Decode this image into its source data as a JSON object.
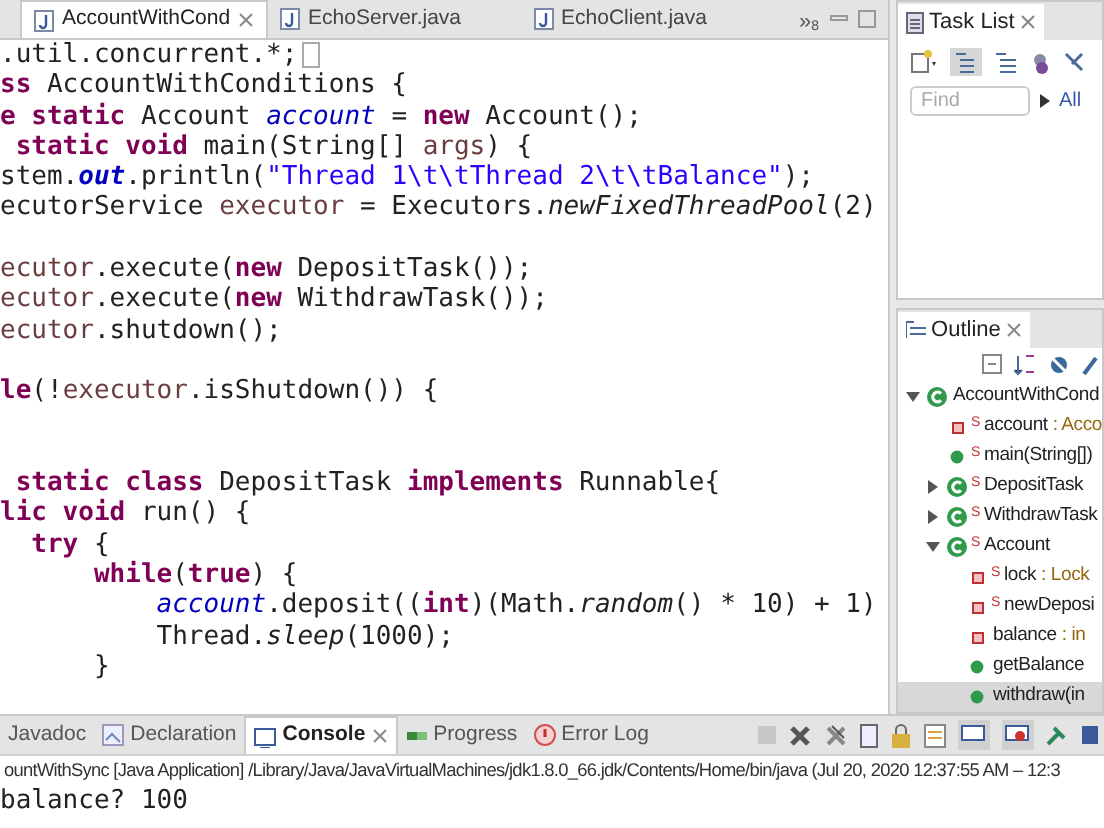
{
  "editor": {
    "imports_folded": true,
    "tabs": [
      {
        "label": "AccountWithCond",
        "selected": true
      },
      {
        "label": "EchoServer.java",
        "selected": false
      },
      {
        "label": "EchoClient.java",
        "selected": false
      }
    ],
    "overflow": {
      "label": "»",
      "count": "8"
    },
    "lines": [
      {
        "kind": "code",
        "tokens": [
          {
            "kind": "plain",
            "text": ".util.concurrent.*;"
          }
        ]
      },
      {
        "kind": "code",
        "tokens": [
          {
            "kind": "keyword",
            "text": "ss"
          },
          {
            "kind": "plain",
            "text": " AccountWithConditions {"
          }
        ]
      },
      {
        "kind": "code",
        "tokens": [
          {
            "kind": "keyword",
            "text": "e static"
          },
          {
            "kind": "plain",
            "text": " Account "
          },
          {
            "kind": "field",
            "text": "account"
          },
          {
            "kind": "plain",
            "text": " = "
          },
          {
            "kind": "keyword",
            "text": "new"
          },
          {
            "kind": "plain",
            "text": " Account();"
          }
        ]
      },
      {
        "kind": "code",
        "tokens": [
          {
            "kind": "keyword",
            "text": " static void"
          },
          {
            "kind": "plain",
            "text": " main(String[] "
          },
          {
            "kind": "variable",
            "text": "args"
          },
          {
            "kind": "plain",
            "text": ") {"
          }
        ]
      },
      {
        "kind": "code",
        "tokens": [
          {
            "kind": "plain",
            "text": "stem."
          },
          {
            "kind": "constant",
            "text": "out"
          },
          {
            "kind": "plain",
            "text": ".println("
          },
          {
            "kind": "string",
            "text": "\"Thread 1\\t\\tThread 2\\t\\tBalance\""
          },
          {
            "kind": "plain",
            "text": ");"
          }
        ]
      },
      {
        "kind": "code",
        "tokens": [
          {
            "kind": "plain",
            "text": "ecutorService "
          },
          {
            "kind": "variable",
            "text": "executor"
          },
          {
            "kind": "plain",
            "text": " = Executors."
          },
          {
            "kind": "static_method",
            "text": "newFixedThreadPool"
          },
          {
            "kind": "plain",
            "text": "(2)"
          }
        ]
      },
      {
        "kind": "blank"
      },
      {
        "kind": "code",
        "tokens": [
          {
            "kind": "variable",
            "text": "ecutor"
          },
          {
            "kind": "plain",
            "text": ".execute("
          },
          {
            "kind": "keyword",
            "text": "new"
          },
          {
            "kind": "plain",
            "text": " DepositTask());"
          }
        ]
      },
      {
        "kind": "code",
        "tokens": [
          {
            "kind": "variable",
            "text": "ecutor"
          },
          {
            "kind": "plain",
            "text": ".execute("
          },
          {
            "kind": "keyword",
            "text": "new"
          },
          {
            "kind": "plain",
            "text": " WithdrawTask());"
          }
        ]
      },
      {
        "kind": "code",
        "tokens": [
          {
            "kind": "variable",
            "text": "ecutor"
          },
          {
            "kind": "plain",
            "text": ".shutdown();"
          }
        ]
      },
      {
        "kind": "blank"
      },
      {
        "kind": "code",
        "tokens": [
          {
            "kind": "keyword",
            "text": "le"
          },
          {
            "kind": "plain",
            "text": "(!"
          },
          {
            "kind": "variable",
            "text": "executor"
          },
          {
            "kind": "plain",
            "text": ".isShutdown()) {"
          }
        ]
      },
      {
        "kind": "blank"
      },
      {
        "kind": "blank"
      },
      {
        "kind": "code",
        "tokens": [
          {
            "kind": "keyword",
            "text": " static class"
          },
          {
            "kind": "plain",
            "text": " DepositTask "
          },
          {
            "kind": "keyword",
            "text": "implements"
          },
          {
            "kind": "plain",
            "text": " Runnable{"
          }
        ]
      },
      {
        "kind": "code",
        "tokens": [
          {
            "kind": "keyword",
            "text": "lic void"
          },
          {
            "kind": "plain",
            "text": " run() {"
          }
        ]
      },
      {
        "kind": "code",
        "tokens": [
          {
            "kind": "keyword",
            "text": "  try"
          },
          {
            "kind": "plain",
            "text": " {"
          }
        ]
      },
      {
        "kind": "code",
        "tokens": [
          {
            "kind": "keyword",
            "text": "      while"
          },
          {
            "kind": "plain",
            "text": "("
          },
          {
            "kind": "keyword",
            "text": "true"
          },
          {
            "kind": "plain",
            "text": ") {"
          }
        ]
      },
      {
        "kind": "code",
        "tokens": [
          {
            "kind": "field",
            "text": "          account"
          },
          {
            "kind": "plain",
            "text": ".deposit(("
          },
          {
            "kind": "keyword",
            "text": "int"
          },
          {
            "kind": "plain",
            "text": ")(Math."
          },
          {
            "kind": "static_method",
            "text": "random"
          },
          {
            "kind": "plain",
            "text": "() * 10) + 1)"
          }
        ]
      },
      {
        "kind": "code",
        "tokens": [
          {
            "kind": "plain",
            "text": "          Thread."
          },
          {
            "kind": "static_method",
            "text": "sleep"
          },
          {
            "kind": "plain",
            "text": "(1000);"
          }
        ]
      },
      {
        "kind": "code",
        "tokens": [
          {
            "kind": "plain",
            "text": "      }"
          }
        ]
      }
    ]
  },
  "task_list": {
    "title": "Task List",
    "find": {
      "placeholder": "Find"
    },
    "filter": "All"
  },
  "outline": {
    "title": "Outline",
    "tree": [
      {
        "kind": "class",
        "label": "AccountWithCond",
        "expanded": true,
        "selected": false,
        "children": [
          {
            "kind": "private_field",
            "label": "account",
            "detail": " : Acco",
            "modifier": "S",
            "selected": false
          },
          {
            "kind": "public_method",
            "label": "main(String[])",
            "modifier": "S",
            "selected": false
          },
          {
            "kind": "class",
            "label": "DepositTask",
            "modifier": "S",
            "expanded": false,
            "selected": false
          },
          {
            "kind": "class",
            "label": "WithdrawTask",
            "modifier": "S",
            "expanded": false,
            "selected": false
          },
          {
            "kind": "class",
            "label": "Account",
            "modifier": "S",
            "expanded": true,
            "selected": false,
            "children": [
              {
                "kind": "private_field",
                "label": "lock",
                "detail": " : Lock",
                "modifier": "S",
                "selected": false
              },
              {
                "kind": "private_field",
                "label": "newDeposi",
                "modifier": "S",
                "selected": false
              },
              {
                "kind": "private_field",
                "label": "balance",
                "detail": " : in",
                "selected": false
              },
              {
                "kind": "public_method",
                "label": "getBalance",
                "selected": false
              },
              {
                "kind": "public_method",
                "label": "withdraw(in",
                "selected": true
              }
            ]
          }
        ]
      }
    ]
  },
  "bottom": {
    "tabs": [
      {
        "label": "Javadoc",
        "selected": false
      },
      {
        "label": "Declaration",
        "selected": false
      },
      {
        "label": "Console",
        "selected": true
      },
      {
        "label": "Progress",
        "selected": false
      },
      {
        "label": "Error Log",
        "selected": false
      }
    ],
    "launch": "ountWithSync [Java Application] /Library/Java/JavaVirtualMachines/jdk1.8.0_66.jdk/Contents/Home/bin/java  (Jul 20, 2020 12:37:55 AM – 12:3",
    "output": "balance? 100"
  }
}
